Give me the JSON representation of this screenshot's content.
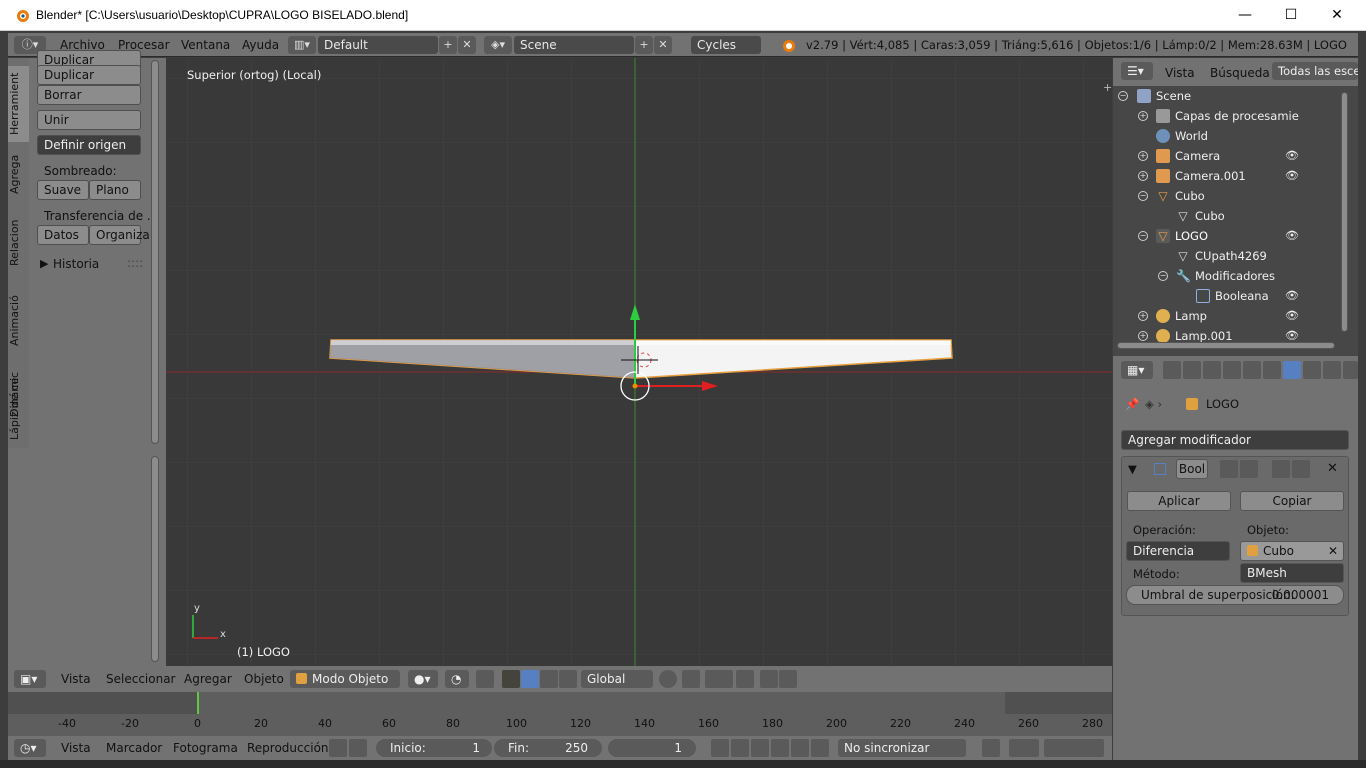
{
  "window": {
    "title": "Blender* [C:\\Users\\usuario\\Desktop\\CUPRA\\LOGO BISELADO.blend]",
    "minimize": "—",
    "maximize": "☐",
    "close": "✕"
  },
  "infobar": {
    "menus": [
      "Archivo",
      "Procesar",
      "Ventana",
      "Ayuda"
    ],
    "layout": "Default",
    "scene": "Scene",
    "engine": "Cycles",
    "stats": "v2.79 | Vért:4,085 | Caras:3,059 | Triáng:5,616 | Objetos:1/6 | Lámp:0/2 | Mem:28.63M | LOGO"
  },
  "tabs": [
    "Herramient",
    "Agrega",
    "Relacion",
    "Animació",
    "Dinámic",
    "Lápiz de ce"
  ],
  "shelf": {
    "partial": "Duplicar",
    "duplicate_linked": "Duplicar vinculado",
    "delete": "Borrar",
    "join": "Unir",
    "set_origin": "Definir origen",
    "shading_label": "Sombreado:",
    "smooth": "Suave",
    "flat": "Plano",
    "transfer_label": "Transferencia de ...",
    "data": "Datos",
    "organize": "Organiza",
    "history": "Historia"
  },
  "viewport": {
    "view_label": "Superior (ortog) (Local)",
    "object_label": "(1) LOGO",
    "axis_y": "y",
    "axis_x": "x"
  },
  "viewheader": {
    "menus": [
      "Vista",
      "Seleccionar",
      "Agregar",
      "Objeto"
    ],
    "mode": "Modo Objeto",
    "orientation": "Global"
  },
  "timeline": {
    "ticks": [
      "-40",
      "-20",
      "0",
      "20",
      "40",
      "60",
      "80",
      "100",
      "120",
      "140",
      "160",
      "180",
      "200",
      "220",
      "240",
      "260",
      "280"
    ],
    "menus": [
      "Vista",
      "Marcador",
      "Fotograma",
      "Reproducción"
    ],
    "start_label": "Inicio:",
    "start": "1",
    "end_label": "Fin:",
    "end": "250",
    "current": "1",
    "sync": "No sincronizar"
  },
  "outliner": {
    "header": [
      "Vista",
      "Búsqueda",
      "Todas las escen"
    ],
    "rows": [
      {
        "label": "Scene"
      },
      {
        "label": "Capas de procesamie"
      },
      {
        "label": "World"
      },
      {
        "label": "Camera"
      },
      {
        "label": "Camera.001"
      },
      {
        "label": "Cubo"
      },
      {
        "label": "Cubo"
      },
      {
        "label": "LOGO"
      },
      {
        "label": "CUpath4269"
      },
      {
        "label": "Modificadores"
      },
      {
        "label": "Booleana"
      },
      {
        "label": "Lamp"
      },
      {
        "label": "Lamp.001"
      }
    ]
  },
  "properties": {
    "object": "LOGO",
    "add_modifier": "Agregar modificador",
    "modifier_name": "Bool",
    "apply": "Aplicar",
    "copy": "Copiar",
    "operation_label": "Operación:",
    "operation": "Diferencia",
    "object_label": "Objeto:",
    "object_value": "Cubo",
    "method_label": "Método:",
    "method": "BMesh",
    "threshold_label": "Umbral de superposición:",
    "threshold": "0.000001"
  }
}
